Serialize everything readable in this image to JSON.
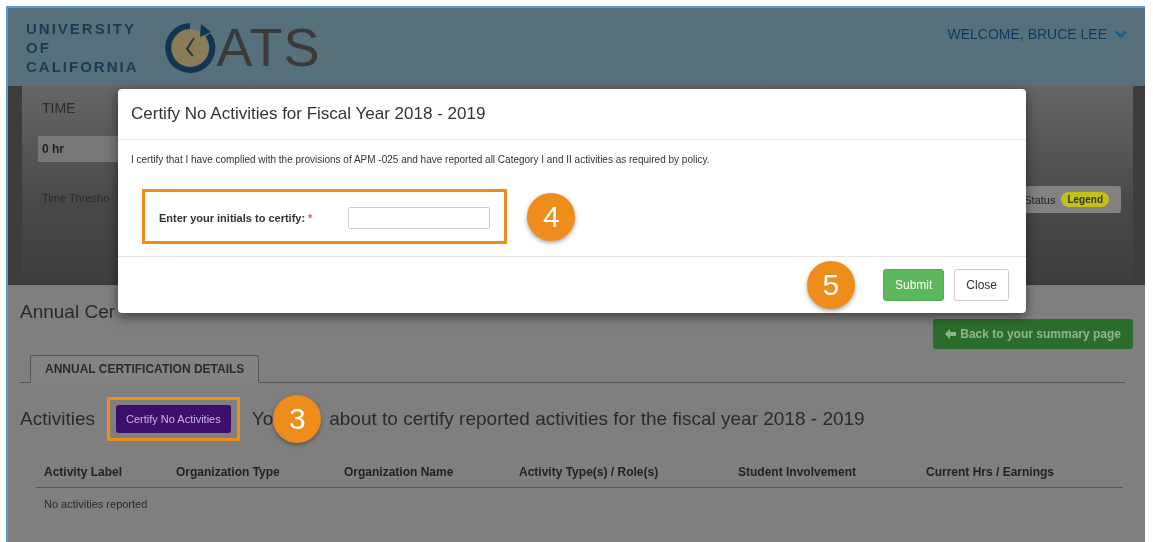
{
  "header": {
    "logo_lines": [
      "UNIVERSITY",
      "OF",
      "CALIFORNIA"
    ],
    "app_name": "ATS",
    "welcome": "WELCOME, BRUCE LEE"
  },
  "summary_panel": {
    "label": "TIME",
    "value": "0 hr",
    "threshold_label": "Time Thresho",
    "status_label": "Status",
    "legend_badge": "Legend"
  },
  "page": {
    "title": "Annual Cer",
    "back_button": "Back to your summary page",
    "tabs": [
      {
        "label": "ANNUAL CERTIFICATION DETAILS",
        "selected": true
      }
    ],
    "activities_label": "Activities",
    "certify_button": "Certify No Activities",
    "certify_callout": "3",
    "certify_message_start": "Yo",
    "certify_message": "about to certify reported activities for the fiscal year 2018 - 2019",
    "table": {
      "columns": [
        "Activity Label",
        "Organization Type",
        "Organization Name",
        "Activity Type(s) / Role(s)",
        "Student Involvement",
        "Current Hrs / Earnings"
      ],
      "empty_message": "No activities reported"
    }
  },
  "dialog": {
    "title": "Certify No Activities for Fiscal Year 2018 - 2019",
    "statement": "I certify that I have complied with the provisions of APM -025 and have reported all Category I and II activities as required by policy.",
    "initials_field": {
      "label": "Enter your initials to certify:",
      "required_mark": "*"
    },
    "initials_callout": "4",
    "buttons_callout": "5",
    "buttons": [
      {
        "label": "Submit",
        "kind": "primary"
      },
      {
        "label": "Close",
        "kind": "default"
      }
    ]
  }
}
